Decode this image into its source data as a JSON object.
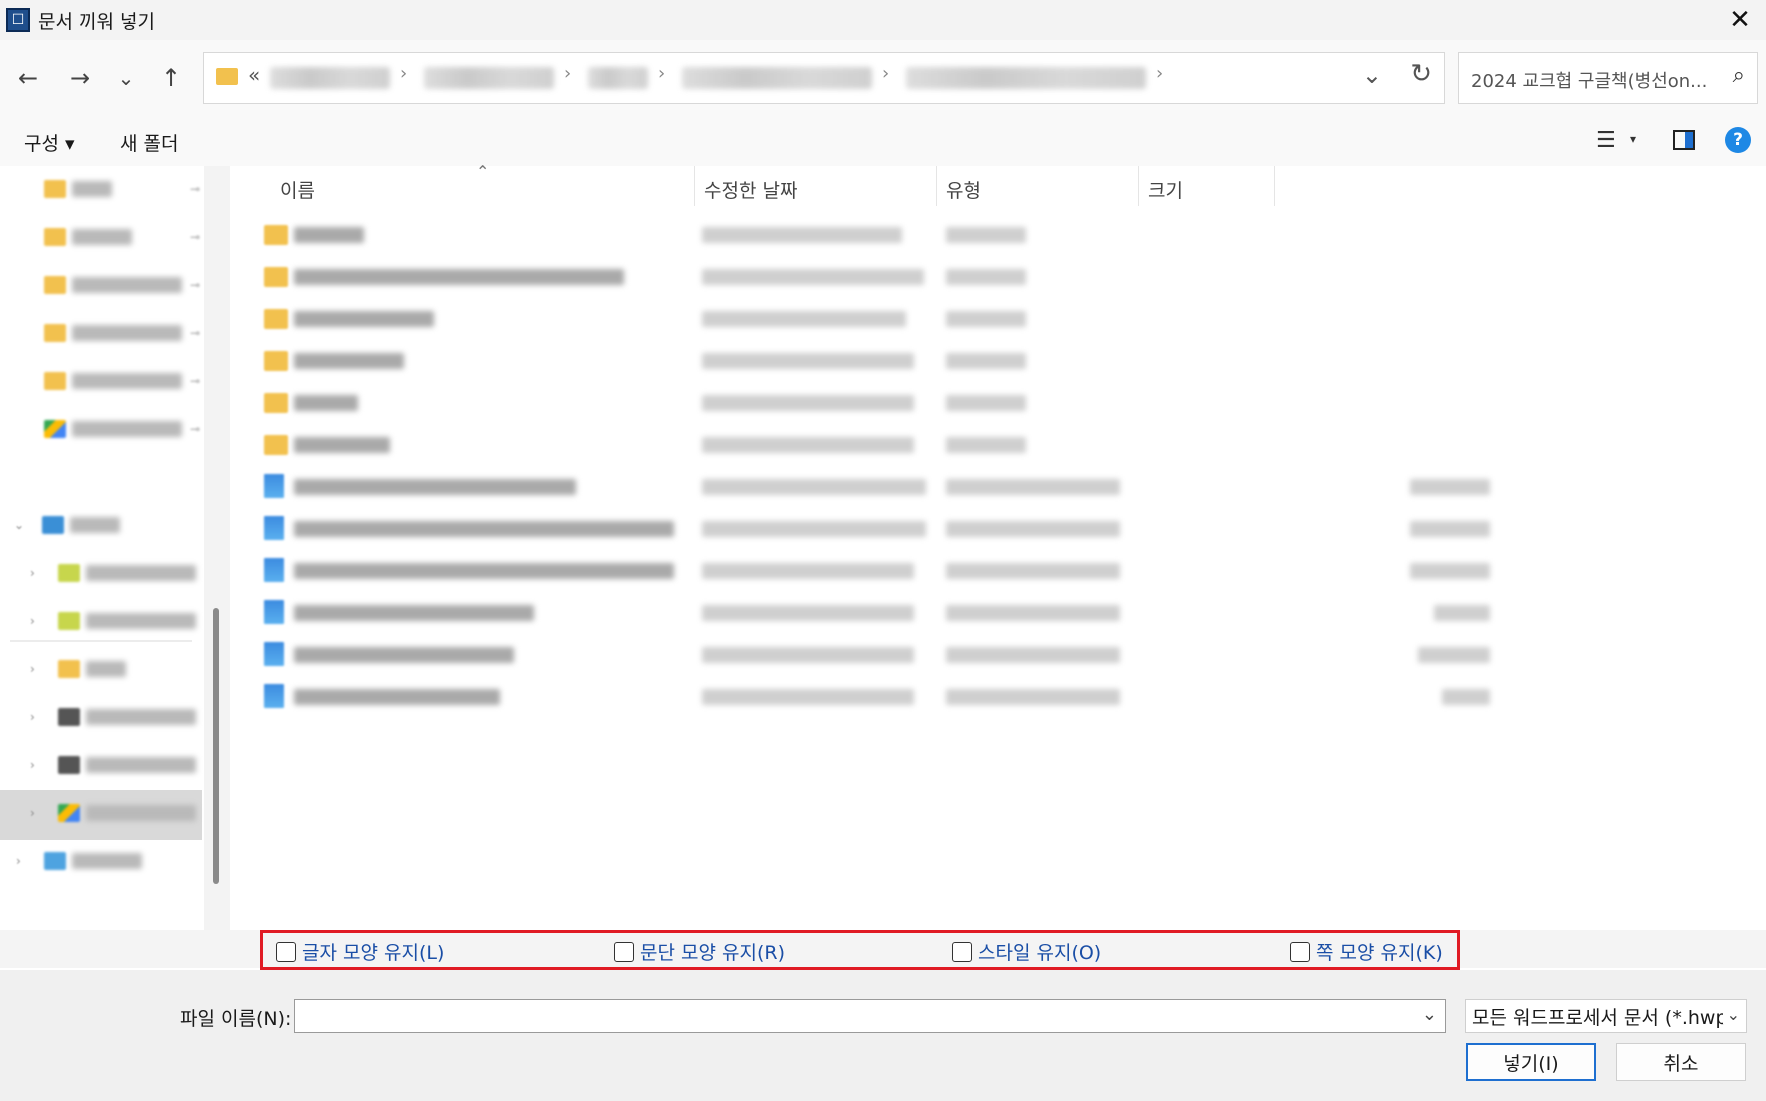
{
  "window": {
    "title": "문서 끼워 넣기",
    "close_glyph": "✕"
  },
  "nav": {
    "back_glyph": "←",
    "forward_glyph": "→",
    "recent_glyph": "⌄",
    "up_glyph": "↑",
    "address_prefix": "«",
    "address_dropdown_glyph": "⌄",
    "refresh_glyph": "↻",
    "search_text": "2024 교크협 구글책(병선on...",
    "search_glyph": "⌕"
  },
  "commands": {
    "organize_label": "구성 ▾",
    "new_folder_label": "새 폴더",
    "view_glyph": "☰",
    "view_caret": "▾",
    "help_glyph": "?"
  },
  "columns": {
    "name": "이름",
    "modified": "수정한 날짜",
    "type": "유형",
    "size": "크기",
    "sort_glyph": "⌃"
  },
  "options": {
    "keep_char_shape": "글자 모양 유지(L)",
    "keep_para_shape": "문단 모양 유지(R)",
    "keep_style": "스타일 유지(O)",
    "keep_page_shape": "쪽 모양 유지(K)"
  },
  "footer": {
    "filename_label": "파일 이름(N):",
    "filename_value": "",
    "filename_dropdown_glyph": "⌄",
    "filetype_value": "모든 워드프로세서 문서 (*.hwp",
    "filetype_dropdown_glyph": "⌄",
    "insert_button": "넣기(I)",
    "cancel_button": "취소"
  },
  "colors": {
    "highlight_box": "#e01b24",
    "option_text": "#1a4ea6",
    "primary_button_border": "#1e6fd0"
  },
  "icons": {
    "app": "hwp-app-icon",
    "folder": "folder-icon",
    "hwp_file": "hwp-file-icon",
    "google_drive": "google-drive-icon",
    "this_pc": "this-pc-icon",
    "network": "network-icon"
  }
}
